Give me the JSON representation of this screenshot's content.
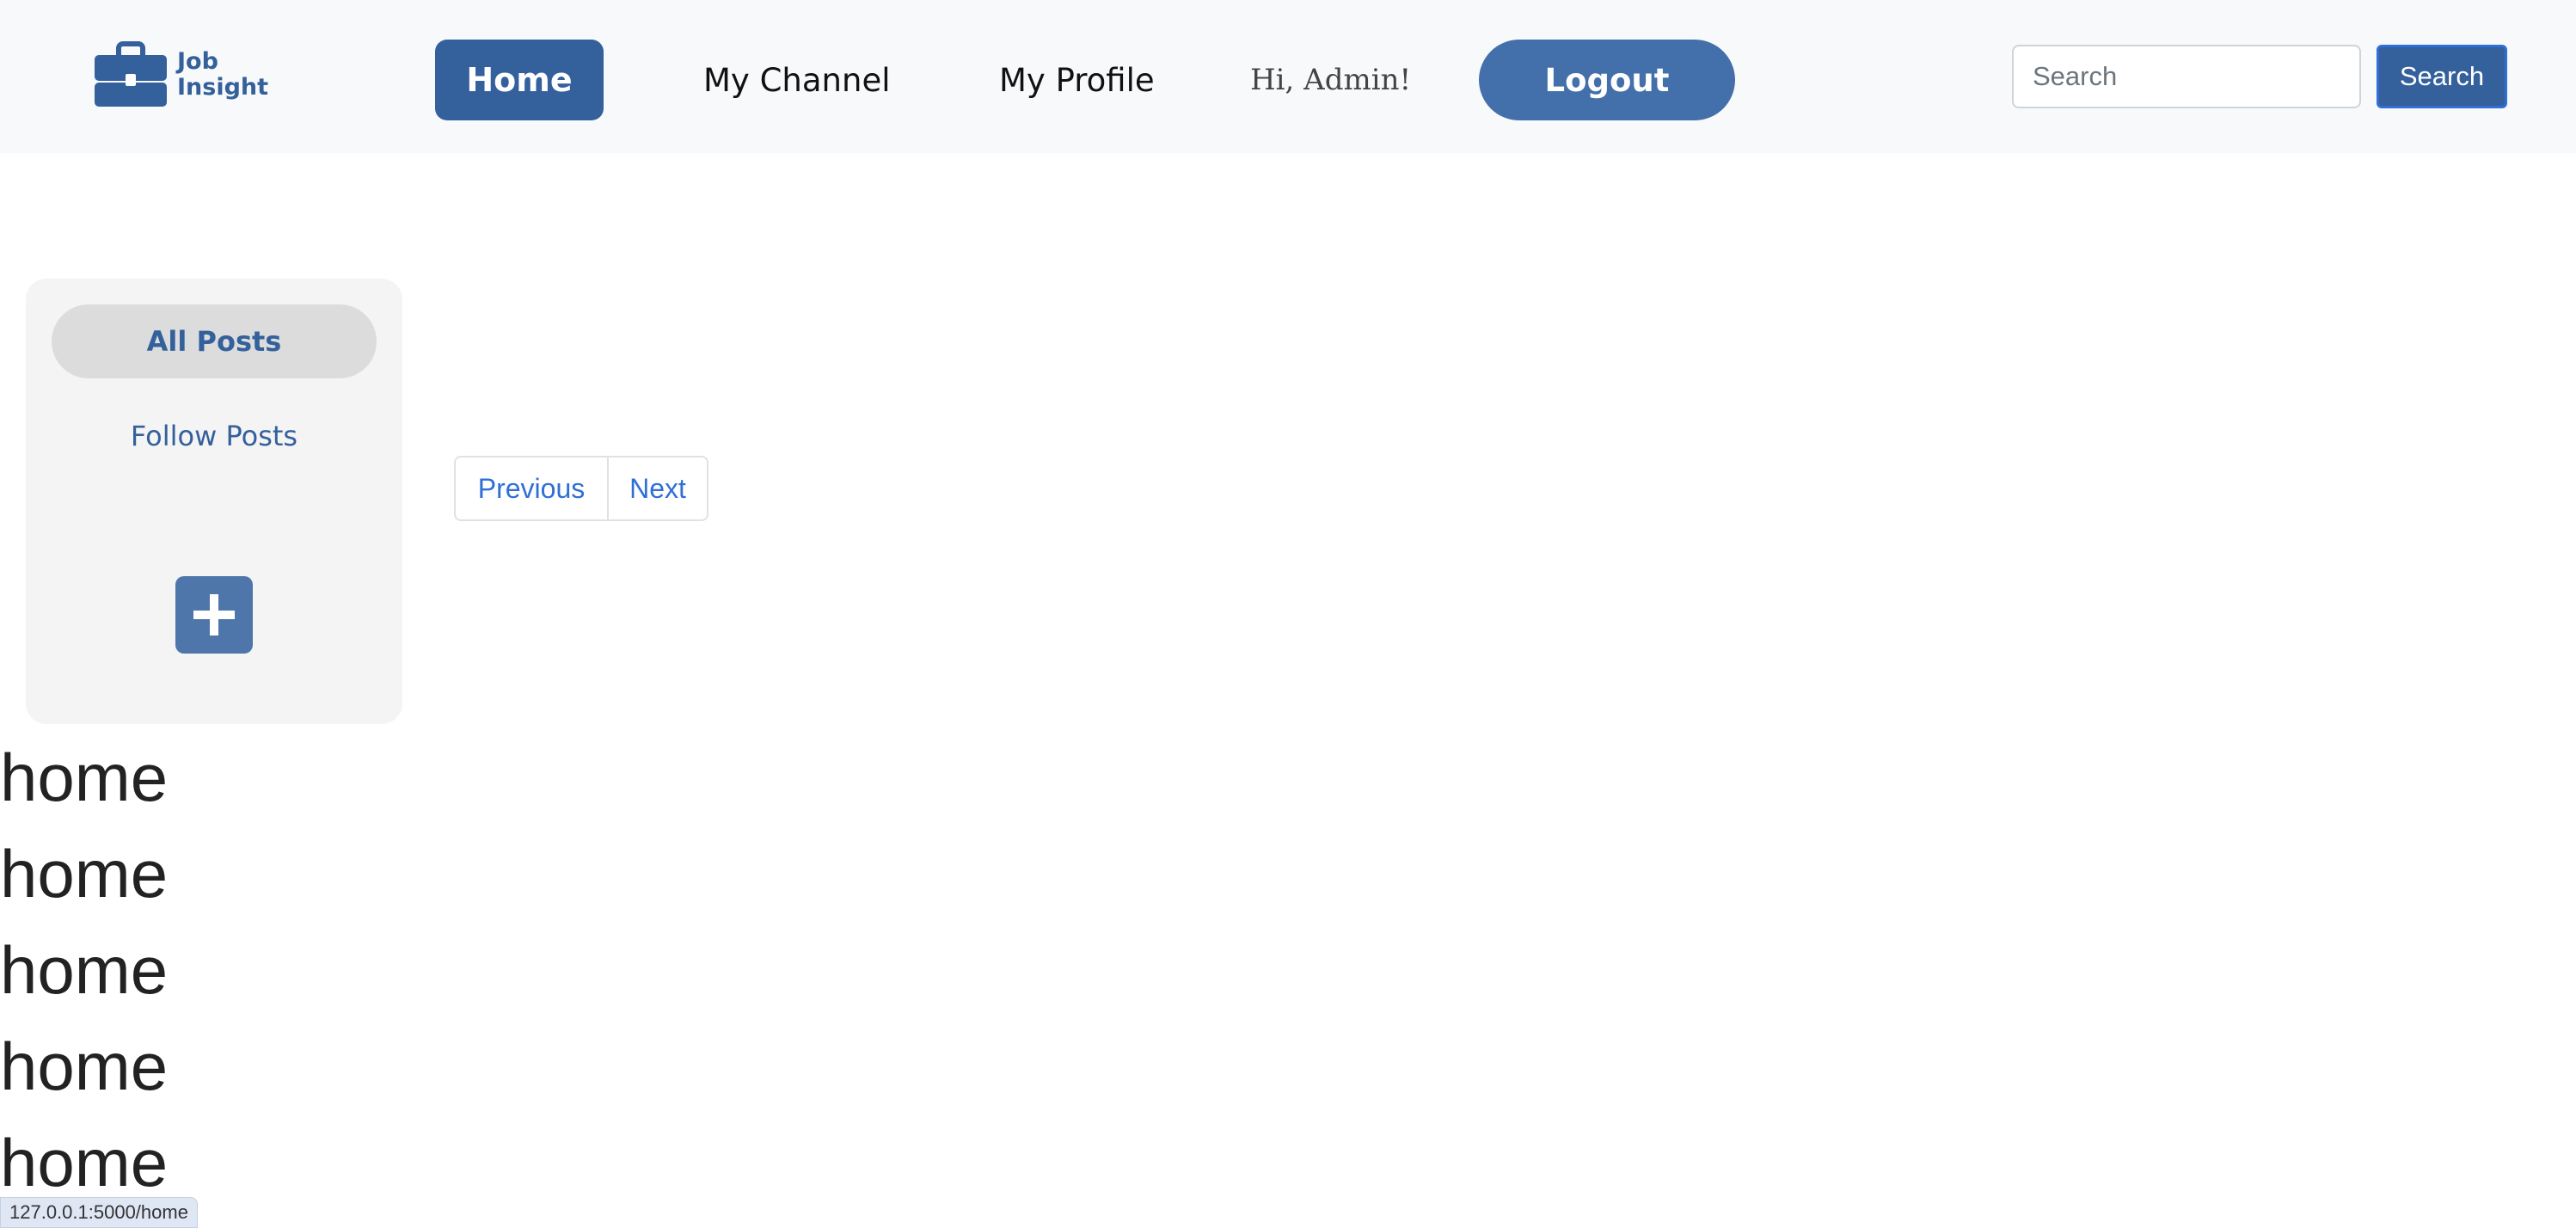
{
  "header": {
    "logo": {
      "line1": "Job",
      "line2": "Insight",
      "icon": "briefcase-icon"
    },
    "nav": {
      "home": "Home",
      "my_channel": "My Channel",
      "my_profile": "My Profile"
    },
    "greeting": "Hi, Admin!",
    "logout": "Logout",
    "search": {
      "placeholder": "Search",
      "value": "",
      "button": "Search"
    }
  },
  "sidebar": {
    "all_posts": "All Posts",
    "follow_posts": "Follow Posts",
    "add_icon": "plus-icon"
  },
  "pagination": {
    "previous": "Previous",
    "next": "Next"
  },
  "posts": [
    "home",
    "home",
    "home",
    "home",
    "home"
  ],
  "status_bar": "127.0.0.1:5000/home",
  "colors": {
    "primary": "#34609c",
    "logout": "#4370aa",
    "link": "#2f6fd6",
    "topbar_bg": "#f8f9fa",
    "sidebar_bg": "#f4f4f4"
  }
}
